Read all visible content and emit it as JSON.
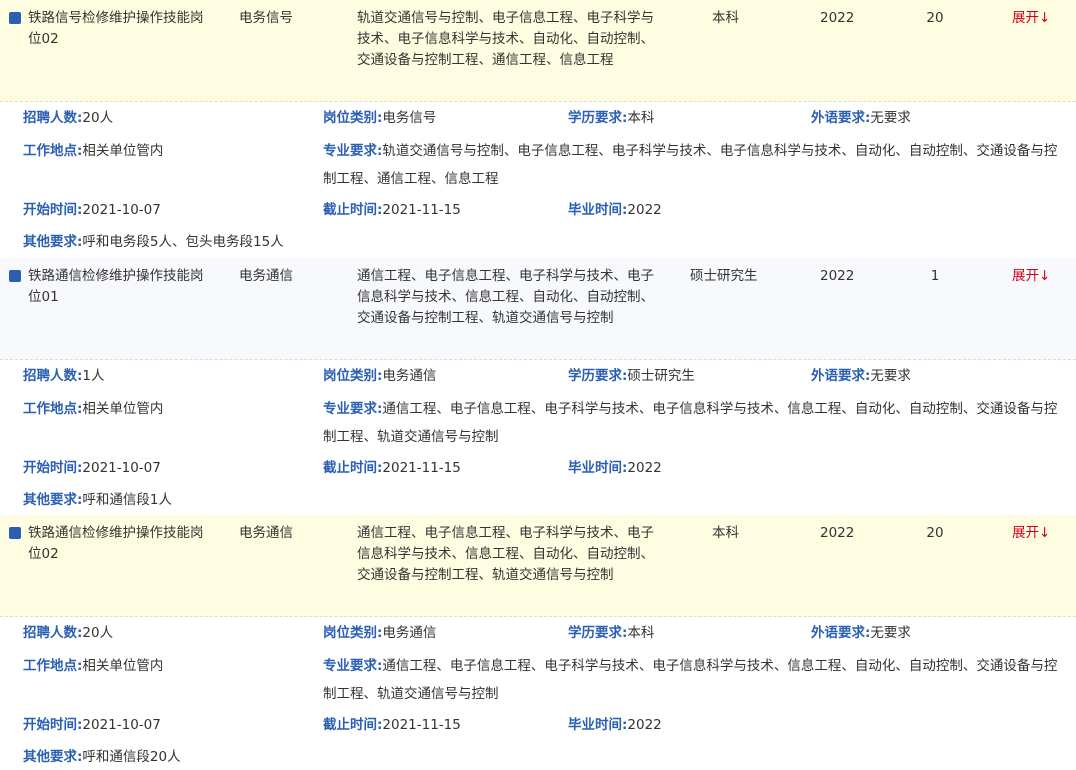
{
  "jobs": [
    {
      "name": "铁路信号检修维护操作技能岗位02",
      "category": "电务信号",
      "majors_short": "轨道交通信号与控制、电子信息工程、电子科学与技术、电子信息科学与技术、自动化、自动控制、交通设备与控制工程、通信工程、信息工程",
      "education": "本科",
      "year": "2022",
      "count": "20",
      "expand": "展开↓",
      "labels": {
        "count": "招聘人数:",
        "type": "岗位类别:",
        "edu": "学历要求:",
        "lang": "外语要求:",
        "place": "工作地点:",
        "major": "专业要求:",
        "start": "开始时间:",
        "end": "截止时间:",
        "grad": "毕业时间:",
        "other": "其他要求:"
      },
      "detail": {
        "count": "20人",
        "type": "电务信号",
        "edu": "本科",
        "lang": "无要求",
        "place": "相关单位管内",
        "major": "轨道交通信号与控制、电子信息工程、电子科学与技术、电子信息科学与技术、自动化、自动控制、交通设备与控制工程、通信工程、信息工程",
        "start": "2021-10-07",
        "end": "2021-11-15",
        "grad": "2022",
        "other": "呼和电务段5人、包头电务段15人"
      }
    },
    {
      "name": "铁路通信检修维护操作技能岗位01",
      "category": "电务通信",
      "majors_short": "通信工程、电子信息工程、电子科学与技术、电子信息科学与技术、信息工程、自动化、自动控制、交通设备与控制工程、轨道交通信号与控制",
      "education": "硕士研究生",
      "year": "2022",
      "count": "1",
      "expand": "展开↓",
      "labels": {
        "count": "招聘人数:",
        "type": "岗位类别:",
        "edu": "学历要求:",
        "lang": "外语要求:",
        "place": "工作地点:",
        "major": "专业要求:",
        "start": "开始时间:",
        "end": "截止时间:",
        "grad": "毕业时间:",
        "other": "其他要求:"
      },
      "detail": {
        "count": "1人",
        "type": "电务通信",
        "edu": "硕士研究生",
        "lang": "无要求",
        "place": "相关单位管内",
        "major": "通信工程、电子信息工程、电子科学与技术、电子信息科学与技术、信息工程、自动化、自动控制、交通设备与控制工程、轨道交通信号与控制",
        "start": "2021-10-07",
        "end": "2021-11-15",
        "grad": "2022",
        "other": "呼和通信段1人"
      }
    },
    {
      "name": "铁路通信检修维护操作技能岗位02",
      "category": "电务通信",
      "majors_short": "通信工程、电子信息工程、电子科学与技术、电子信息科学与技术、信息工程、自动化、自动控制、交通设备与控制工程、轨道交通信号与控制",
      "education": "本科",
      "year": "2022",
      "count": "20",
      "expand": "展开↓",
      "labels": {
        "count": "招聘人数:",
        "type": "岗位类别:",
        "edu": "学历要求:",
        "lang": "外语要求:",
        "place": "工作地点:",
        "major": "专业要求:",
        "start": "开始时间:",
        "end": "截止时间:",
        "grad": "毕业时间:",
        "other": "其他要求:"
      },
      "detail": {
        "count": "20人",
        "type": "电务通信",
        "edu": "本科",
        "lang": "无要求",
        "place": "相关单位管内",
        "major": "通信工程、电子信息工程、电子科学与技术、电子信息科学与技术、信息工程、自动化、自动控制、交通设备与控制工程、轨道交通信号与控制",
        "start": "2021-10-07",
        "end": "2021-11-15",
        "grad": "2022",
        "other": "呼和通信段20人"
      }
    }
  ]
}
